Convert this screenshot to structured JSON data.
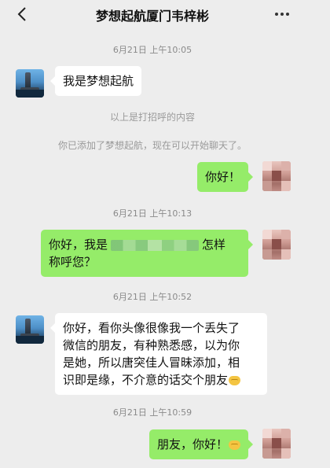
{
  "header": {
    "back_icon": "back-chevron-icon",
    "title": "梦想起航厦门韦梓彬",
    "more_icon": "more-dots-icon"
  },
  "messages": {
    "ts1": "6月21日 上午10:05",
    "m1": "我是梦想起航",
    "sys1": "以上是打招呼的内容",
    "sys2": "你已添加了梦想起航，现在可以开始聊天了。",
    "m2": "你好！",
    "ts2": "6月21日 上午10:13",
    "m3_a": "你好，我是",
    "m3_b": "怎样",
    "m3_c": "称呼您？",
    "ts3": "6月21日 上午10:52",
    "m4_l1": "你好，看你头像很像我一个丢失了",
    "m4_l2": "微信的朋友，有种熟悉感，以为你",
    "m4_l3": "是她，所以唐突佳人冒昧添加，相",
    "m4_l4": "识即是缘，不介意的话交个朋友",
    "ts4": "6月21日 上午10:59",
    "m5": "朋友，你好！"
  },
  "colors": {
    "background": "#ededed",
    "bubble_self": "#95ec69",
    "bubble_other": "#ffffff"
  }
}
